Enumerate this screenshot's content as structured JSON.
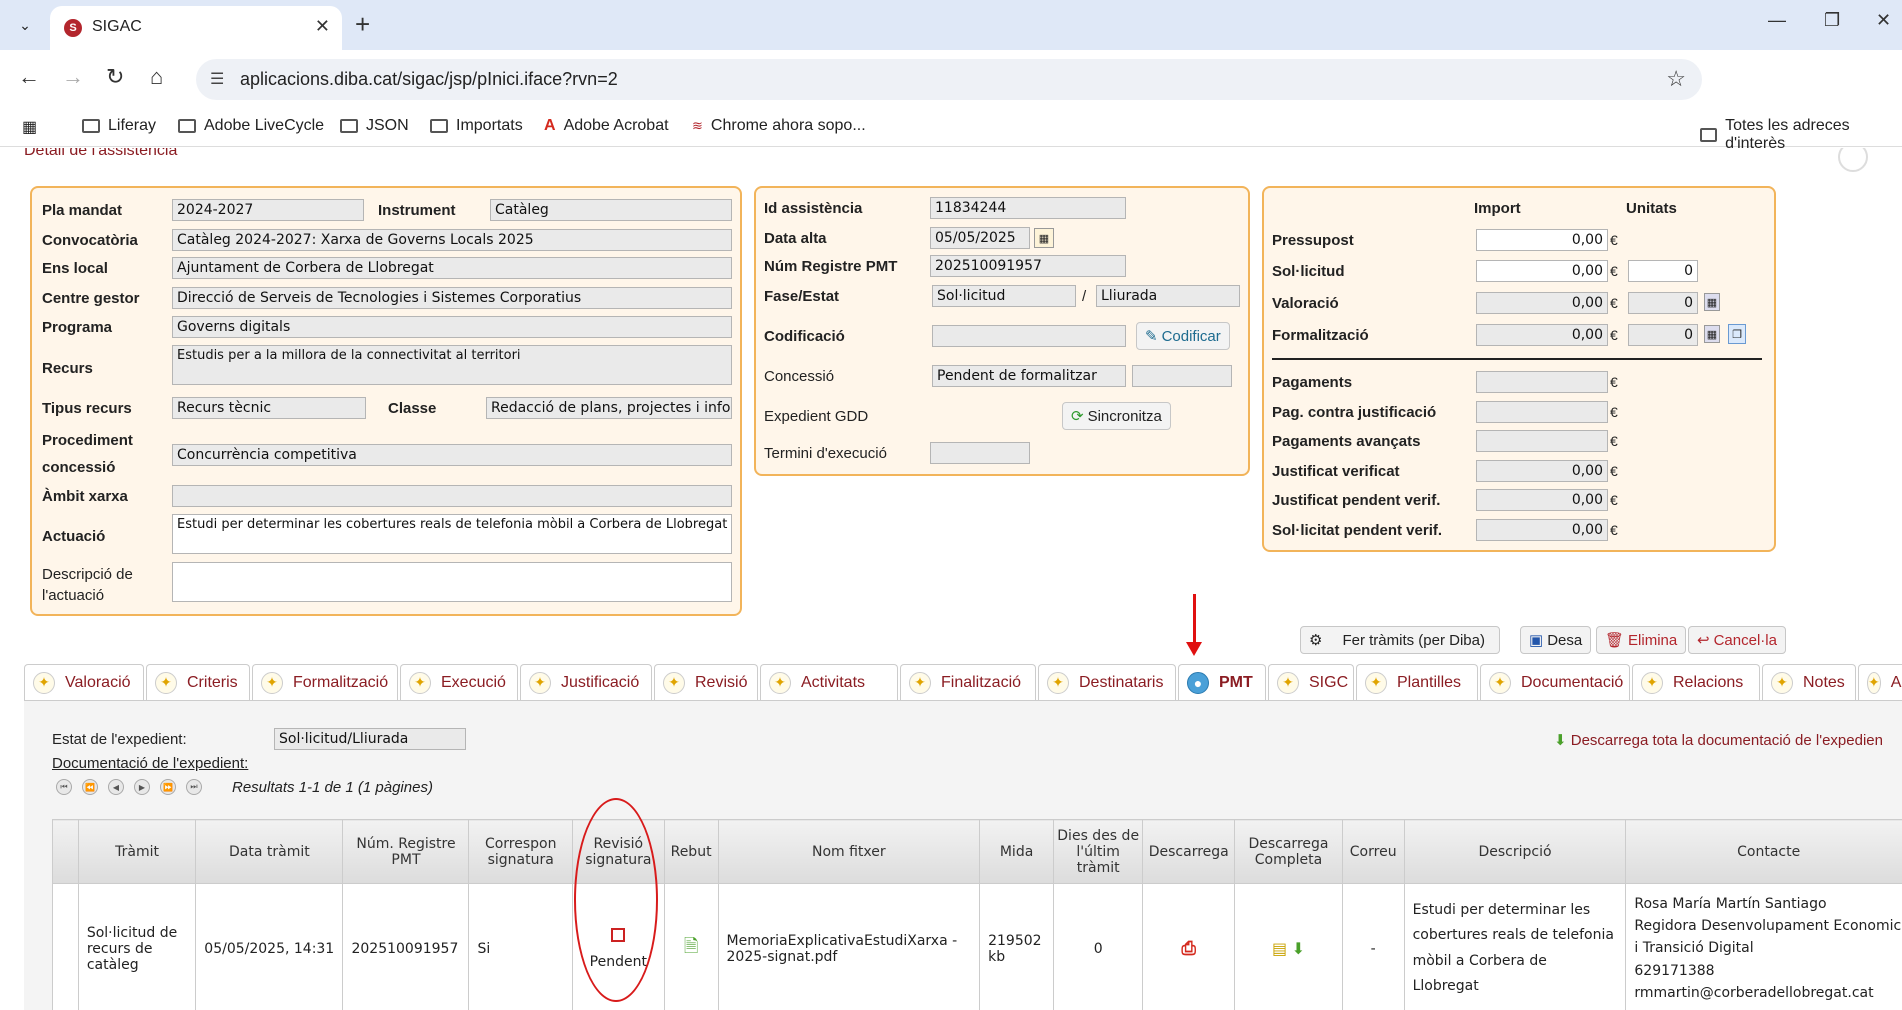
{
  "browser": {
    "tab_title": "SIGAC",
    "favicon_text": "S",
    "url": "aplicacions.diba.cat/sigac/jsp/pInici.iface?rvn=2",
    "bookmarks": [
      "Liferay",
      "Adobe LiveCycle",
      "JSON",
      "Importats",
      "Adobe Acrobat",
      "Chrome ahora sopo..."
    ],
    "all_bookmarks": "Totes les adreces d'interès"
  },
  "page": {
    "section_title": "Detall de l'assistència"
  },
  "left_panel": {
    "pla_mandat_label": "Pla mandat",
    "pla_mandat": "2024-2027",
    "instrument_label": "Instrument",
    "instrument": "Catàleg",
    "convocatoria_label": "Convocatòria",
    "convocatoria": "Catàleg 2024-2027: Xarxa de Governs Locals 2025",
    "ens_local_label": "Ens local",
    "ens_local": "Ajuntament de Corbera de Llobregat",
    "centre_gestor_label": "Centre gestor",
    "centre_gestor": "Direcció de Serveis de Tecnologies i Sistemes Corporatius",
    "programa_label": "Programa",
    "programa": "Governs digitals",
    "recurs_label": "Recurs",
    "recurs": "Estudis per a la millora de la connectivitat al territori",
    "tipus_recurs_label": "Tipus recurs",
    "tipus_recurs": "Recurs tècnic",
    "classe_label": "Classe",
    "classe": "Redacció de plans, projectes i info",
    "procediment_label_1": "Procediment",
    "procediment_label_2": "concessió",
    "procediment": "Concurrència competitiva",
    "ambit_label": "Àmbit xarxa",
    "ambit": "",
    "actuacio_label": "Actuació",
    "actuacio": "Estudi per determinar les cobertures reals de telefonia mòbil a Corbera de Llobregat",
    "descripcio_label_1": "Descripció de",
    "descripcio_label_2": "l'actuació",
    "descripcio": ""
  },
  "mid_panel": {
    "id_label": "Id assistència",
    "id": "11834244",
    "data_alta_label": "Data alta",
    "data_alta": "05/05/2025",
    "registre_label": "Núm Registre PMT",
    "registre": "202510091957",
    "fase_label": "Fase/Estat",
    "fase": "Sol·licitud",
    "slash": "/",
    "estat": "Lliurada",
    "codificacio_label": "Codificació",
    "codificar_btn": "Codificar",
    "concessio_label": "Concessió",
    "concessio": "Pendent de formalitzar",
    "gdd_label": "Expedient GDD",
    "sincronitza_btn": "Sincronitza",
    "termini_label": "Termini d'execució"
  },
  "right_panel": {
    "import_header": "Import",
    "unitats_header": "Unitats",
    "euro": "€",
    "pressupost_label": "Pressupost",
    "pressupost": "0,00",
    "solicitud_label": "Sol·licitud",
    "solicitud": "0,00",
    "solicitud_units": "0",
    "valoracio_label": "Valoració",
    "valoracio": "0,00",
    "valoracio_units": "0",
    "formalitzacio_label": "Formalització",
    "formalitzacio": "0,00",
    "formalitzacio_units": "0",
    "pagaments_label": "Pagaments",
    "pag_contra_label": "Pag. contra justificació",
    "pag_avancats_label": "Pagaments avançats",
    "just_verif_label": "Justificat verificat",
    "just_verif": "0,00",
    "just_pend_label": "Justificat pendent verif.",
    "just_pend": "0,00",
    "sol_pend_label": "Sol·licitat pendent verif.",
    "sol_pend": "0,00"
  },
  "actions": {
    "tramits": "Fer tràmits (per Diba)",
    "desa": "Desa",
    "elimina": "Elimina",
    "cancela": "Cancel·la"
  },
  "tabs": [
    "Valoració",
    "Criteris",
    "Formalització",
    "Execució",
    "Justificació",
    "Revisió",
    "Activitats",
    "Finalització",
    "Destinataris",
    "PMT",
    "SIGC",
    "Plantilles",
    "Documentació",
    "Relacions",
    "Notes",
    "Adm"
  ],
  "pmt": {
    "estat_label": "Estat de l'expedient:",
    "estat_value": "Sol·licitud/Lliurada",
    "doc_label": "Documentació de l'expedient:",
    "download_all": "Descarrega tota la documentació de l'expedien",
    "results": "Resultats 1-1 de 1 (1 pàgines)",
    "columns": [
      "Tràmit",
      "Data tràmit",
      "Núm. Registre PMT",
      "Correspon signatura",
      "Revisió signatura",
      "Rebut",
      "Nom fitxer",
      "Mida",
      "Dies des de l'últim tràmit",
      "Descarrega",
      "Descarrega Completa",
      "Correu",
      "Descripció",
      "Contacte"
    ],
    "row": {
      "tramit": "Sol·licitud de recurs de catàleg",
      "data": "05/05/2025, 14:31",
      "registre": "202510091957",
      "correspon": "Si",
      "revisio": "Pendent",
      "fitxer": "MemoriaExplicativaEstudiXarxa - 2025-signat.pdf",
      "mida": "219502 kb",
      "dies": "0",
      "correu": "-",
      "descripcio": "Estudi per determinar les cobertures reals de telefonia mòbil a Corbera de Llobregat",
      "contacte_nom": "Rosa María Martín Santiago",
      "contacte_carrec": "Regidora Desenvolupament Economic i Transició Digital",
      "contacte_tel": "629171388",
      "contacte_mail": "rmmartin@corberadellobregat.cat"
    }
  }
}
